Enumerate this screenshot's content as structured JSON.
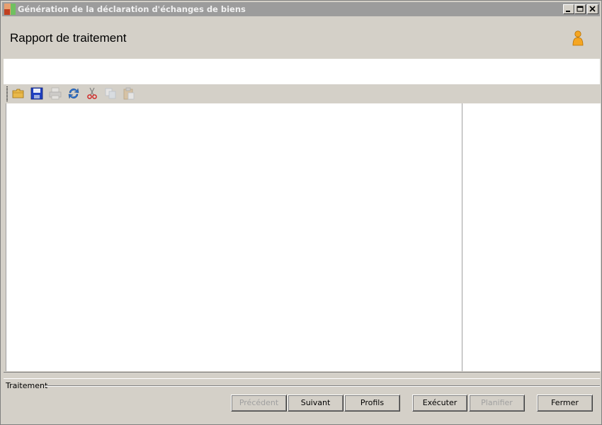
{
  "window": {
    "title": "Génération de la déclaration d'échanges de biens"
  },
  "header": {
    "title": "Rapport de traitement",
    "user_icon": "user-icon"
  },
  "toolbar": {
    "items": [
      {
        "name": "open-folder-icon",
        "enabled": true
      },
      {
        "name": "save-icon",
        "enabled": true
      },
      {
        "name": "print-icon",
        "enabled": false
      },
      {
        "name": "refresh-icon",
        "enabled": true
      },
      {
        "name": "cut-icon",
        "enabled": true
      },
      {
        "name": "copy-icon",
        "enabled": false
      },
      {
        "name": "paste-icon",
        "enabled": false
      }
    ]
  },
  "status": {
    "label": "Traitement"
  },
  "buttons": {
    "previous": "Précédent",
    "next": "Suivant",
    "profiles": "Profils",
    "execute": "Exécuter",
    "schedule": "Planifier",
    "close": "Fermer"
  },
  "colors": {
    "titlebar": "#9c9c9c",
    "background": "#d4d0c8",
    "accent_orange": "#f0a020"
  }
}
